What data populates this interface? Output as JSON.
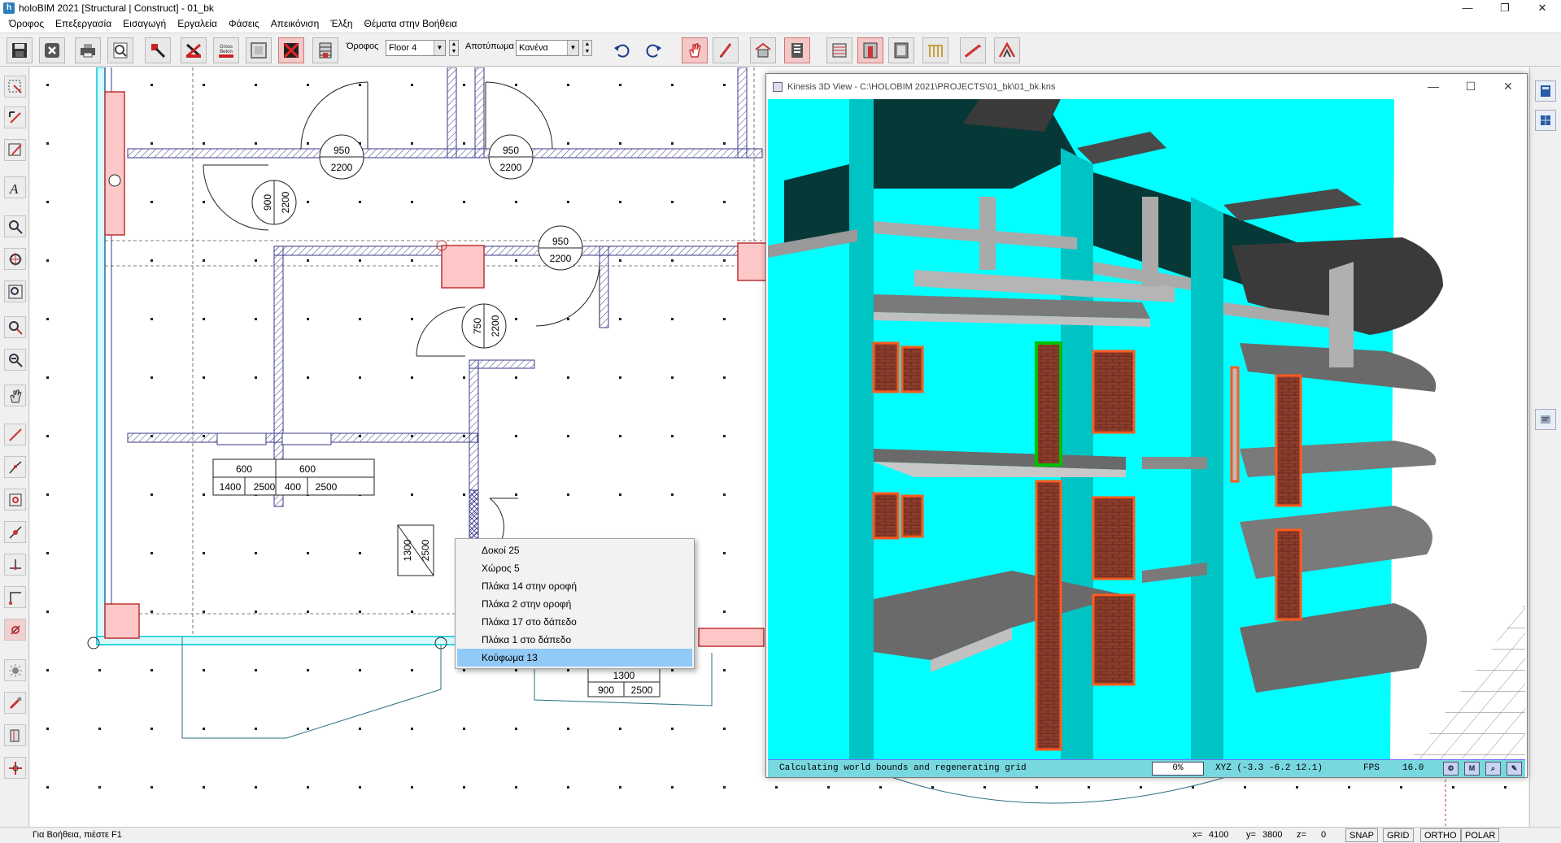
{
  "window": {
    "title": "holoBIM 2021 [Structural | Construct] - 01_bk",
    "app_icon": "h",
    "minimize": "—",
    "restore": "❐",
    "close": "✕"
  },
  "menu": [
    "Όροφος",
    "Επεξεργασία",
    "Εισαγωγή",
    "Εργαλεία",
    "Φάσεις",
    "Απεικόνιση",
    "Έλξη",
    "Θέματα στην Βοήθεια"
  ],
  "toolbar": {
    "floor_label": "Όροφος",
    "floor_value": "Floor 4",
    "stamp_label": "Αποτύπωμα",
    "stamp_value": "Κανένα",
    "gross_label_1": "Gross",
    "gross_label_2": "Beton"
  },
  "drawing": {
    "dim_950_a": "950",
    "dim_2200_a": "2200",
    "dim_950_b": "950",
    "dim_2200_b": "2200",
    "dim_900_c": "900",
    "dim_2200_c": "2200",
    "dim_950_d": "950",
    "dim_2200_d": "2200",
    "dim_750_e": "750",
    "dim_2200_e": "2200",
    "win_600_a": "600",
    "win_600_b": "600",
    "win_1400": "1400",
    "win_2500_a": "2500",
    "win_400": "400",
    "win_2500_b": "2500",
    "box_1300": "1300",
    "box_2500": "2500",
    "bot_1300": "1300",
    "bot_900": "900",
    "bot_2500": "2500"
  },
  "context_menu": {
    "items": [
      "Δοκοί 25",
      "Χώρος 5",
      "Πλάκα 14 στην οροφή",
      "Πλάκα 2 στην οροφή",
      "Πλάκα 17 στο δάπεδο",
      "Πλάκα 1 στο δάπεδο",
      "Κούφωμα 13"
    ],
    "selected": "Κούφωμα 13"
  },
  "view3d": {
    "title": "Kinesis 3D View - C:\\HOLOBIM 2021\\PROJECTS\\01_bk\\01_bk.kns",
    "status_message": "Calculating world bounds and regenerating grid",
    "progress": "0%",
    "xyz": "XYZ (-3.3 -6.2 12.1)",
    "fps_label": "FPS",
    "fps_value": "16.0",
    "btn_m": "M",
    "colors": {
      "building": "#00ffff",
      "slab": "#8a8a8a",
      "brick": "#8c3c2c",
      "frame": "#ff5a1e"
    }
  },
  "statusbar": {
    "help": "Για Βοήθεια, πιέστε F1",
    "x_label": "x=",
    "x_value": "4100",
    "y_label": "y=",
    "y_value": "3800",
    "z_label": "z=",
    "z_value": "0",
    "snap": "SNAP",
    "grid": "GRID",
    "ortho": "ORTHO",
    "polar": "POLAR"
  },
  "colors": {
    "column_fill": "#ffc8c8",
    "column_stroke": "#c03030",
    "wall_hatch": "#3a3a8a",
    "cyan_outline": "#00c8d8"
  }
}
